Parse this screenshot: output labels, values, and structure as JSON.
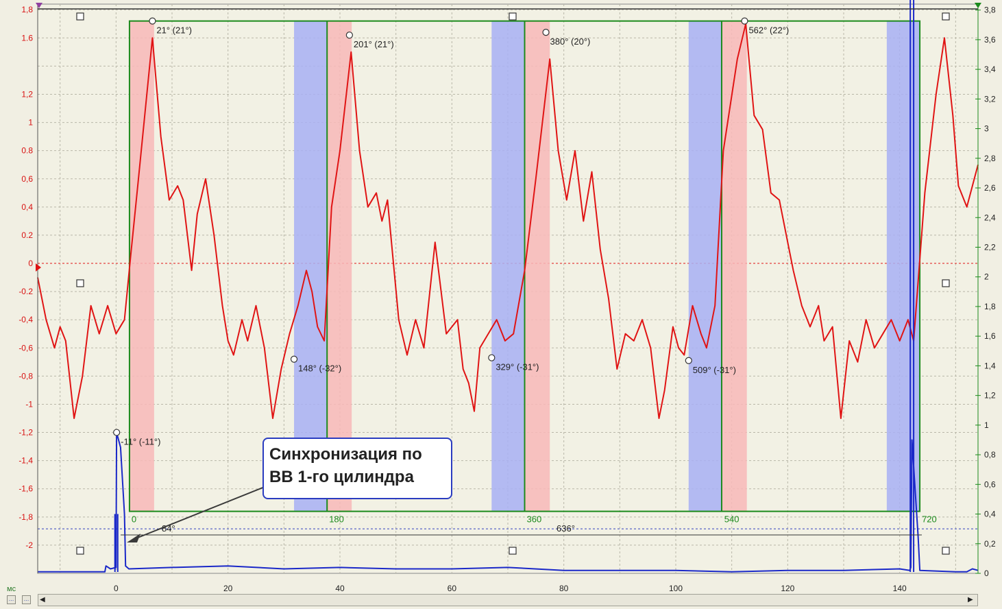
{
  "units_label": "мс",
  "callout": {
    "line1": "Синхронизация по",
    "line2": "ВВ 1-го цилиндра"
  },
  "measurements": {
    "short_span": "84°",
    "long_span": "636°"
  },
  "colors": {
    "background": "#f1efe3",
    "plot_background": "#f2f1e4",
    "grid": "#b9b7a8",
    "signal": "#e01414",
    "sync": "#1a28c8",
    "cycle_frame": "#1c8a1c",
    "intake_band": "#f8b8b8",
    "exhaust_band": "#a8b0f4"
  },
  "chart_data": {
    "type": "line",
    "x_axis": {
      "ticks": [
        0,
        20,
        40,
        60,
        80,
        100,
        120,
        140
      ],
      "range": [
        -14,
        154
      ]
    },
    "left_axis": {
      "ticks": [
        "1,8",
        "1.6",
        "1,2",
        "1",
        "0.8",
        "0,6",
        "0,4",
        "0.2",
        "0",
        "-0.2",
        "-0,4",
        "-0,6",
        "-0,8",
        "-1",
        "-1,2",
        "-1,4",
        "-1,6",
        "-1,8",
        "-2"
      ],
      "tick_values": [
        1.8,
        1.6,
        1.2,
        1,
        0.8,
        0.6,
        0.4,
        0.2,
        0,
        -0.2,
        -0.4,
        -0.6,
        -0.8,
        -1,
        -1.2,
        -1.4,
        -1.6,
        -1.8,
        -2
      ],
      "range": [
        -2.2,
        1.84
      ]
    },
    "right_axis": {
      "ticks": [
        "3,8",
        "3,6",
        "3,4",
        "3,2",
        "3",
        "2,8",
        "2,6",
        "2,4",
        "2,2",
        "2",
        "1,8",
        "1,6",
        "1,4",
        "1,2",
        "1",
        "0,8",
        "0,6",
        "0,4",
        "0,2",
        "0"
      ],
      "tick_values": [
        3.8,
        3.6,
        3.4,
        3.2,
        3,
        2.8,
        2.6,
        2.4,
        2.2,
        2,
        1.8,
        1.6,
        1.4,
        1.2,
        1,
        0.8,
        0.6,
        0.4,
        0.2,
        0
      ],
      "range": [
        0,
        3.84
      ]
    },
    "degree_axis": {
      "ticks": [
        "0",
        "180",
        "360",
        "540",
        "720"
      ],
      "values": [
        0,
        180,
        360,
        540,
        720
      ],
      "ms_start": 2.4,
      "ms_end": 143.6
    },
    "series": [
      {
        "axis": "left",
        "points": [
          [
            -14,
            -0.1
          ],
          [
            -12.5,
            -0.4
          ],
          [
            -11,
            -0.6
          ],
          [
            -10,
            -0.45
          ],
          [
            -9,
            -0.55
          ],
          [
            -7.5,
            -1.1
          ],
          [
            -6,
            -0.8
          ],
          [
            -4.5,
            -0.3
          ],
          [
            -3,
            -0.5
          ],
          [
            -1.5,
            -0.3
          ],
          [
            0,
            -0.5
          ],
          [
            1.5,
            -0.4
          ],
          [
            2.6,
            0.05
          ],
          [
            4,
            0.6
          ],
          [
            6.5,
            1.6
          ],
          [
            8,
            0.9
          ],
          [
            9.5,
            0.45
          ],
          [
            11,
            0.55
          ],
          [
            12,
            0.45
          ],
          [
            13.5,
            -0.05
          ],
          [
            14.5,
            0.35
          ],
          [
            16,
            0.6
          ],
          [
            17.5,
            0.2
          ],
          [
            19,
            -0.3
          ],
          [
            20,
            -0.55
          ],
          [
            21,
            -0.65
          ],
          [
            22.5,
            -0.4
          ],
          [
            23.5,
            -0.55
          ],
          [
            25,
            -0.3
          ],
          [
            26.5,
            -0.6
          ],
          [
            28,
            -1.1
          ],
          [
            29.5,
            -0.75
          ],
          [
            31,
            -0.5
          ],
          [
            32.5,
            -0.3
          ],
          [
            34,
            -0.05
          ],
          [
            35,
            -0.2
          ],
          [
            36,
            -0.45
          ],
          [
            37.2,
            -0.55
          ],
          [
            38.5,
            0.4
          ],
          [
            40,
            0.8
          ],
          [
            42,
            1.5
          ],
          [
            43.5,
            0.8
          ],
          [
            45,
            0.4
          ],
          [
            46.5,
            0.5
          ],
          [
            47.5,
            0.3
          ],
          [
            48.5,
            0.45
          ],
          [
            50.5,
            -0.4
          ],
          [
            52,
            -0.65
          ],
          [
            53.5,
            -0.4
          ],
          [
            55,
            -0.6
          ],
          [
            57,
            0.15
          ],
          [
            59,
            -0.5
          ],
          [
            61,
            -0.4
          ],
          [
            62,
            -0.75
          ],
          [
            63,
            -0.85
          ],
          [
            64,
            -1.05
          ],
          [
            65,
            -0.6
          ],
          [
            66.5,
            -0.5
          ],
          [
            68,
            -0.4
          ],
          [
            69.5,
            -0.55
          ],
          [
            71,
            -0.5
          ],
          [
            73,
            -0.05
          ],
          [
            75,
            0.6
          ],
          [
            77.5,
            1.45
          ],
          [
            79,
            0.8
          ],
          [
            80.5,
            0.45
          ],
          [
            82,
            0.8
          ],
          [
            83.5,
            0.3
          ],
          [
            85,
            0.65
          ],
          [
            86.5,
            0.1
          ],
          [
            88,
            -0.25
          ],
          [
            89.5,
            -0.75
          ],
          [
            91,
            -0.5
          ],
          [
            92.5,
            -0.55
          ],
          [
            94,
            -0.4
          ],
          [
            95.5,
            -0.6
          ],
          [
            97,
            -1.1
          ],
          [
            98,
            -0.9
          ],
          [
            99.5,
            -0.45
          ],
          [
            100.5,
            -0.6
          ],
          [
            101.5,
            -0.65
          ],
          [
            103,
            -0.3
          ],
          [
            104.5,
            -0.5
          ],
          [
            105.5,
            -0.6
          ],
          [
            107,
            -0.3
          ],
          [
            108.5,
            0.8
          ],
          [
            111,
            1.45
          ],
          [
            112.5,
            1.7
          ],
          [
            114,
            1.05
          ],
          [
            115.5,
            0.95
          ],
          [
            117,
            0.5
          ],
          [
            118.5,
            0.45
          ],
          [
            120,
            0.15
          ],
          [
            121,
            -0.05
          ],
          [
            122.5,
            -0.3
          ],
          [
            124,
            -0.45
          ],
          [
            125.5,
            -0.3
          ],
          [
            126.5,
            -0.55
          ],
          [
            128,
            -0.45
          ],
          [
            129.5,
            -1.1
          ],
          [
            131,
            -0.55
          ],
          [
            132.5,
            -0.7
          ],
          [
            134,
            -0.4
          ],
          [
            135.5,
            -0.6
          ],
          [
            137,
            -0.5
          ],
          [
            138.5,
            -0.4
          ],
          [
            140,
            -0.55
          ],
          [
            141.5,
            -0.4
          ],
          [
            142.5,
            -0.55
          ],
          [
            144.5,
            0.5
          ],
          [
            146.5,
            1.2
          ],
          [
            148,
            1.6
          ],
          [
            149.5,
            1.05
          ],
          [
            150.5,
            0.55
          ],
          [
            152,
            0.4
          ],
          [
            154,
            0.7
          ]
        ]
      },
      {
        "axis": "right",
        "points": [
          [
            -14,
            0.01
          ],
          [
            -2,
            0.01
          ],
          [
            -1.8,
            0.05
          ],
          [
            -1,
            0.03
          ],
          [
            0,
            0.04
          ],
          [
            0.1,
            0.95
          ],
          [
            0.8,
            0.85
          ],
          [
            1.5,
            0.4
          ],
          [
            1.7,
            0.05
          ],
          [
            2.3,
            0.03
          ],
          [
            10,
            0.04
          ],
          [
            20,
            0.05
          ],
          [
            30,
            0.03
          ],
          [
            40,
            0.04
          ],
          [
            50,
            0.03
          ],
          [
            60,
            0.03
          ],
          [
            70,
            0.04
          ],
          [
            80,
            0.02
          ],
          [
            90,
            0.02
          ],
          [
            100,
            0.02
          ],
          [
            110,
            0.01
          ],
          [
            120,
            0.02
          ],
          [
            130,
            0.02
          ],
          [
            140,
            0.03
          ],
          [
            141.8,
            0.02
          ],
          [
            142,
            0.04
          ],
          [
            142.2,
            0.9
          ],
          [
            143.3,
            0.25
          ],
          [
            143.6,
            0.02
          ],
          [
            150,
            0.01
          ],
          [
            152,
            0.01
          ],
          [
            153,
            0.03
          ],
          [
            154,
            0.02
          ]
        ]
      }
    ],
    "cycle_frame": {
      "from_ms": 2.4,
      "to_ms": 143.6,
      "top": 1.72,
      "bottom": -1.76
    },
    "cylinder_dividers_ms": [
      37.7,
      73.0,
      108.2
    ],
    "intake_bands_ms": [
      [
        2.4,
        6.8
      ],
      [
        37.7,
        42.1
      ],
      [
        73.0,
        77.5
      ],
      [
        108.2,
        112.7
      ]
    ],
    "exhaust_bands_ms": [
      [
        31.8,
        37.7
      ],
      [
        67.1,
        73.0
      ],
      [
        102.3,
        108.2
      ],
      [
        137.7,
        143.6
      ]
    ],
    "markers": [
      {
        "x": 6.5,
        "y": 1.72,
        "label": "21° (21°)"
      },
      {
        "x": 41.7,
        "y": 1.62,
        "label": "201° (21°)"
      },
      {
        "x": 76.8,
        "y": 1.64,
        "label": "380° (20°)"
      },
      {
        "x": 112.3,
        "y": 1.72,
        "label": "562° (22°)"
      },
      {
        "x": 31.8,
        "y": -0.68,
        "label": "148° (-32°)"
      },
      {
        "x": 67.1,
        "y": -0.67,
        "label": "329° (-31°)"
      },
      {
        "x": 102.3,
        "y": -0.69,
        "label": "509° (-31°)"
      },
      {
        "x": 0.1,
        "y": -1.2,
        "label": "-11° (-11°)"
      }
    ],
    "zero_line": 0,
    "grid": true
  }
}
